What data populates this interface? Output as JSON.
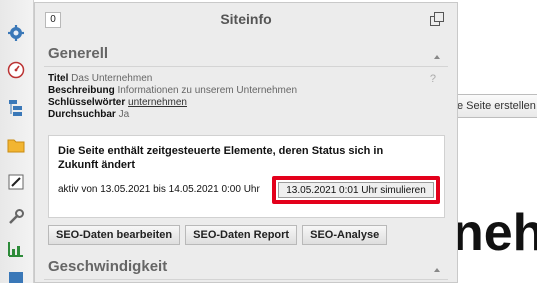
{
  "background": {
    "create_button_label": "e Seite erstellen",
    "heading_fragment": "neh"
  },
  "sidebar": {
    "icons": [
      "gear-icon",
      "dashboard-icon",
      "sitemap-icon",
      "folder-icon",
      "edit-icon",
      "wrench-icon",
      "statistics-icon",
      "misc-icon"
    ]
  },
  "panel": {
    "badge": "0",
    "title": "Siteinfo",
    "sections": {
      "general": {
        "title": "Generell"
      },
      "speed": {
        "title": "Geschwindigkeit"
      }
    },
    "info": {
      "title_label": "Titel",
      "title_value": "Das Unternehmen",
      "description_label": "Beschreibung",
      "description_value": "Informationen zu unserem Unternehmen",
      "keywords_label": "Schlüsselwörter",
      "keywords_value": "unternehmen",
      "searchable_label": "Durchsuchbar",
      "searchable_value": "Ja",
      "help": "?"
    },
    "notice": {
      "text": "Die Seite enthält zeitgesteuerte Elemente, deren Status sich in Zukunft ändert",
      "range": "aktiv von 13.05.2021 bis 14.05.2021 0:00 Uhr",
      "simulate_label": "13.05.2021 0:01 Uhr simulieren"
    },
    "buttons": {
      "seo_edit": "SEO-Daten bearbeiten",
      "seo_report": "SEO-Daten Report",
      "seo_analysis": "SEO-Analyse"
    }
  },
  "colors": {
    "highlight": "#e3001b",
    "panel_bg": "#ececec"
  }
}
